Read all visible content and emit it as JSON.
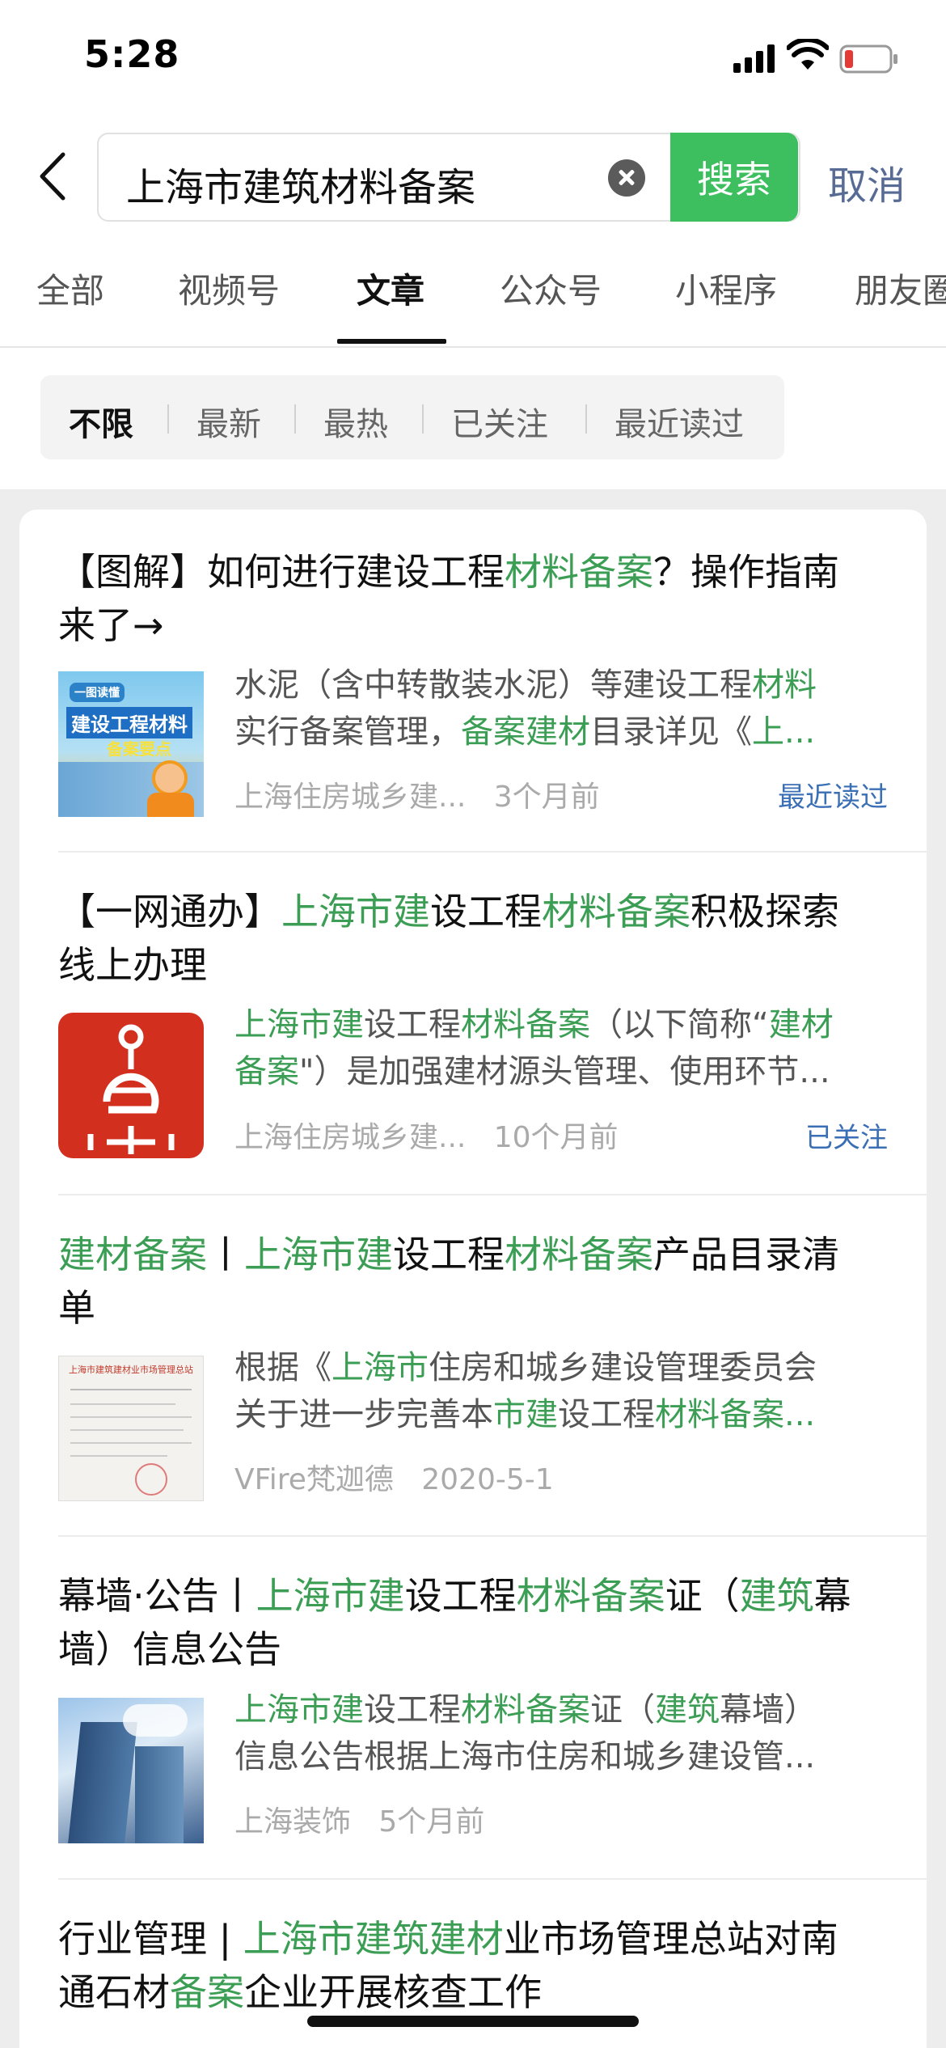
{
  "status_bar": {
    "time": "5:28"
  },
  "search": {
    "query": "上海市建筑材料备案",
    "search_label": "搜索",
    "cancel_label": "取消"
  },
  "tabs": [
    {
      "label": "全部"
    },
    {
      "label": "视频号"
    },
    {
      "label": "文章",
      "active": true
    },
    {
      "label": "公众号"
    },
    {
      "label": "小程序"
    },
    {
      "label": "朋友圈"
    }
  ],
  "filters": [
    {
      "label": "不限",
      "active": true
    },
    {
      "label": "最新"
    },
    {
      "label": "最热"
    },
    {
      "label": "已关注"
    },
    {
      "label": "最近读过"
    }
  ],
  "results": [
    {
      "title": [
        {
          "text": "【图解】如何进行建设工程"
        },
        {
          "text": "材料备案",
          "hl": true
        },
        {
          "text": "？操作指南来了→"
        }
      ],
      "snippet_lines": [
        [
          {
            "text": "水泥（含中转散装水泥）等建设工程"
          },
          {
            "text": "材料",
            "hl": true
          }
        ],
        [
          {
            "text": "实行备案管理，"
          },
          {
            "text": "备案建材",
            "hl": true
          },
          {
            "text": "目录详见《"
          },
          {
            "text": "上...",
            "hl": true
          }
        ]
      ],
      "thumb_text": [
        "一图读懂",
        "建设工程材料",
        "备案要点"
      ],
      "source": "上海住房城乡建...",
      "date": "3个月前",
      "tag": "最近读过"
    },
    {
      "title": [
        {
          "text": "【一网通办】"
        },
        {
          "text": "上海市建",
          "hl": true
        },
        {
          "text": "设工程"
        },
        {
          "text": "材料备案",
          "hl": true
        },
        {
          "text": "积极探索线上办理"
        }
      ],
      "snippet_lines": [
        [
          {
            "text": "上海市建",
            "hl": true
          },
          {
            "text": "设工程"
          },
          {
            "text": "材料备案",
            "hl": true
          },
          {
            "text": "（以下简称“"
          },
          {
            "text": "建材",
            "hl": true
          }
        ],
        [
          {
            "text": "备案",
            "hl": true
          },
          {
            "text": "\"）是加强建材源头管理、使用环节..."
          }
        ]
      ],
      "source": "上海住房城乡建...",
      "date": "10个月前",
      "tag": "已关注"
    },
    {
      "title": [
        {
          "text": "建材备案",
          "hl": true
        },
        {
          "text": "丨"
        },
        {
          "text": "上海市建",
          "hl": true
        },
        {
          "text": "设工程"
        },
        {
          "text": "材料备案",
          "hl": true
        },
        {
          "text": "产品目录清单"
        }
      ],
      "snippet_lines": [
        [
          {
            "text": "根据《"
          },
          {
            "text": "上海市",
            "hl": true
          },
          {
            "text": "住房和城乡建设管理委员会"
          }
        ],
        [
          {
            "text": "关于进一步完善本"
          },
          {
            "text": "市建",
            "hl": true
          },
          {
            "text": "设工程"
          },
          {
            "text": "材料备案...",
            "hl": true
          }
        ]
      ],
      "thumb_text": [
        "上海市建筑建材业市场管理总站"
      ],
      "source": "VFire梵迦德",
      "date": "2020-5-1",
      "tag": ""
    },
    {
      "title": [
        {
          "text": "幕墙·公告丨"
        },
        {
          "text": "上海市建",
          "hl": true
        },
        {
          "text": "设工程"
        },
        {
          "text": "材料备案",
          "hl": true
        },
        {
          "text": "证（"
        },
        {
          "text": "建筑",
          "hl": true
        },
        {
          "text": "幕墙）信息公告"
        }
      ],
      "snippet_lines": [
        [
          {
            "text": "上海市建",
            "hl": true
          },
          {
            "text": "设工程"
          },
          {
            "text": "材料备案",
            "hl": true
          },
          {
            "text": "证（"
          },
          {
            "text": "建筑",
            "hl": true
          },
          {
            "text": "幕墙）"
          }
        ],
        [
          {
            "text": "信息公告根据上海市住房和城乡建设管..."
          }
        ]
      ],
      "source": "上海装饰",
      "date": "5个月前",
      "tag": ""
    },
    {
      "title": [
        {
          "text": "行业管理 | "
        },
        {
          "text": "上海市建筑建材",
          "hl": true
        },
        {
          "text": "业市场管理总站对南通石材"
        },
        {
          "text": "备案",
          "hl": true
        },
        {
          "text": "企业开展核查工作"
        }
      ]
    }
  ],
  "colors": {
    "accent_green": "#3dbf60",
    "highlight_green": "#3b9e54",
    "link_blue": "#576b95",
    "tag_blue": "#3a6fb5",
    "battery_red": "#e53935"
  }
}
